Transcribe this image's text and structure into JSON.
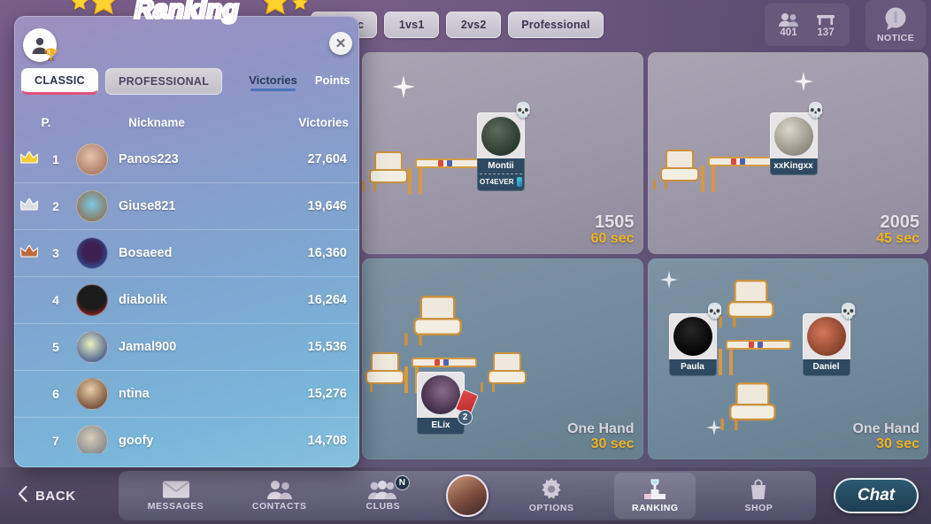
{
  "topbar": {
    "mode_tabs": [
      {
        "label": "Classic",
        "name": "tab-classic"
      },
      {
        "label": "1vs1",
        "name": "tab-1vs1"
      },
      {
        "label": "2vs2",
        "name": "tab-2vs2"
      },
      {
        "label": "Professional",
        "name": "tab-professional"
      }
    ],
    "players_online": "401",
    "tables_open": "137",
    "notice_label": "NOTICE",
    "players_icon": "people-icon",
    "tables_icon": "table-icon",
    "notice_icon": "speech-bubble-icon"
  },
  "tables": [
    {
      "stake": "1505",
      "timer": "60 sec",
      "mode": "",
      "players": [
        {
          "name": "Montii",
          "club": "OT4EVER",
          "has_skull": true
        }
      ]
    },
    {
      "stake": "2005",
      "timer": "45 sec",
      "mode": "",
      "players": [
        {
          "name": "xxKingxx",
          "club": "",
          "has_skull": true
        }
      ]
    },
    {
      "stake": "",
      "timer": "30 sec",
      "mode": "One Hand",
      "players": [
        {
          "name": "ELix",
          "club": "",
          "has_skull": false,
          "seat_badge": "2"
        }
      ]
    },
    {
      "stake": "",
      "timer": "30 sec",
      "mode": "One Hand",
      "players": [
        {
          "name": "Paula",
          "club": "",
          "has_skull": true
        },
        {
          "name": "Daniel",
          "club": "",
          "has_skull": true
        }
      ]
    }
  ],
  "ranking": {
    "title": "Ranking",
    "close_label": "✕",
    "profile_icon": "profile-trophy-icon",
    "segments": [
      {
        "label": "CLASSIC",
        "active": true
      },
      {
        "label": "PROFESSIONAL",
        "active": false
      }
    ],
    "subtabs": [
      {
        "label": "Victories",
        "active": true
      },
      {
        "label": "Points",
        "active": false
      }
    ],
    "columns": {
      "position": "P.",
      "nickname": "Nickname",
      "value": "Victories"
    },
    "rows": [
      {
        "pos": "1",
        "nick": "Panos223",
        "value": "27,604",
        "crown": "gold"
      },
      {
        "pos": "2",
        "nick": "Giuse821",
        "value": "19,646",
        "crown": "silver"
      },
      {
        "pos": "3",
        "nick": "Bosaeed",
        "value": "16,360",
        "crown": "bronze"
      },
      {
        "pos": "4",
        "nick": "diabolik",
        "value": "16,264",
        "crown": ""
      },
      {
        "pos": "5",
        "nick": "Jamal900",
        "value": "15,536",
        "crown": ""
      },
      {
        "pos": "6",
        "nick": "ntina",
        "value": "15,276",
        "crown": ""
      },
      {
        "pos": "7",
        "nick": "goofy",
        "value": "14,708",
        "crown": ""
      }
    ]
  },
  "bottomnav": {
    "back_label": "BACK",
    "back_icon": "chevron-left-icon",
    "items": [
      {
        "label": "MESSAGES",
        "icon": "envelope-icon",
        "active": false,
        "badge": ""
      },
      {
        "label": "CONTACTS",
        "icon": "people-icon",
        "active": false,
        "badge": ""
      },
      {
        "label": "CLUBS",
        "icon": "group-icon",
        "active": false,
        "badge": "N"
      },
      {
        "label": "OPTIONS",
        "icon": "gear-icon",
        "active": false,
        "badge": ""
      },
      {
        "label": "RANKING",
        "icon": "podium-icon",
        "active": true,
        "badge": ""
      },
      {
        "label": "SHOP",
        "icon": "shopping-bag-icon",
        "active": false,
        "badge": ""
      }
    ],
    "chat_label": "Chat",
    "avatar_name": "user-avatar"
  },
  "colors": {
    "accent_pink": "#e2517c",
    "accent_blue": "#4a74b8",
    "timer_gold": "#f0b323",
    "panel_top": "#9f8fc0",
    "panel_bottom": "#86c2de"
  }
}
